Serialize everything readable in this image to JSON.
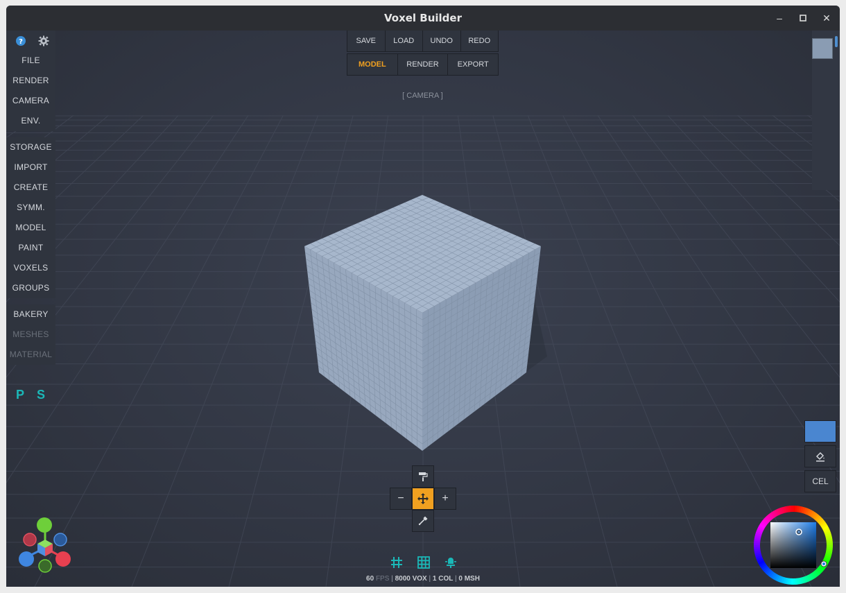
{
  "window": {
    "title": "Voxel Builder",
    "minimize_glyph": "–",
    "maximize_glyph": "▫",
    "close_glyph": "✕"
  },
  "left_menu": {
    "top_icons": [
      "help-icon",
      "gear-icon"
    ],
    "group1": [
      "FILE",
      "RENDER",
      "CAMERA",
      "ENV."
    ],
    "group2": [
      "STORAGE",
      "IMPORT",
      "CREATE",
      "SYMM.",
      "MODEL",
      "PAINT",
      "VOXELS",
      "GROUPS"
    ],
    "group3": [
      "BAKERY",
      "MESHES",
      "MATERIAL"
    ],
    "p_label": "P",
    "s_label": "S"
  },
  "top_toolbar": {
    "row1": [
      "SAVE",
      "LOAD",
      "UNDO",
      "REDO"
    ],
    "row2": [
      "MODEL",
      "RENDER",
      "EXPORT"
    ],
    "active_tab": "MODEL"
  },
  "camera_label": "[ CAMERA ]",
  "right_panel": {
    "cel_label": "CEL",
    "current_color": "#4a86d0",
    "bucket_icon": "paint-bucket-icon"
  },
  "tools": {
    "paint_roller": "paint-roller-icon",
    "minus": "−",
    "move": "move-icon",
    "plus": "+",
    "eyedropper": "eyedropper-icon"
  },
  "status": {
    "fps": "60",
    "fps_unit": "FPS",
    "vox": "8000",
    "vox_unit": "VOX",
    "col": "1",
    "col_unit": "COL",
    "msh": "0",
    "msh_unit": "MSH",
    "sep": "|"
  },
  "colors": {
    "accent": "#f0a020",
    "cube": "#9aaec6",
    "teal": "#1bb8b8"
  }
}
